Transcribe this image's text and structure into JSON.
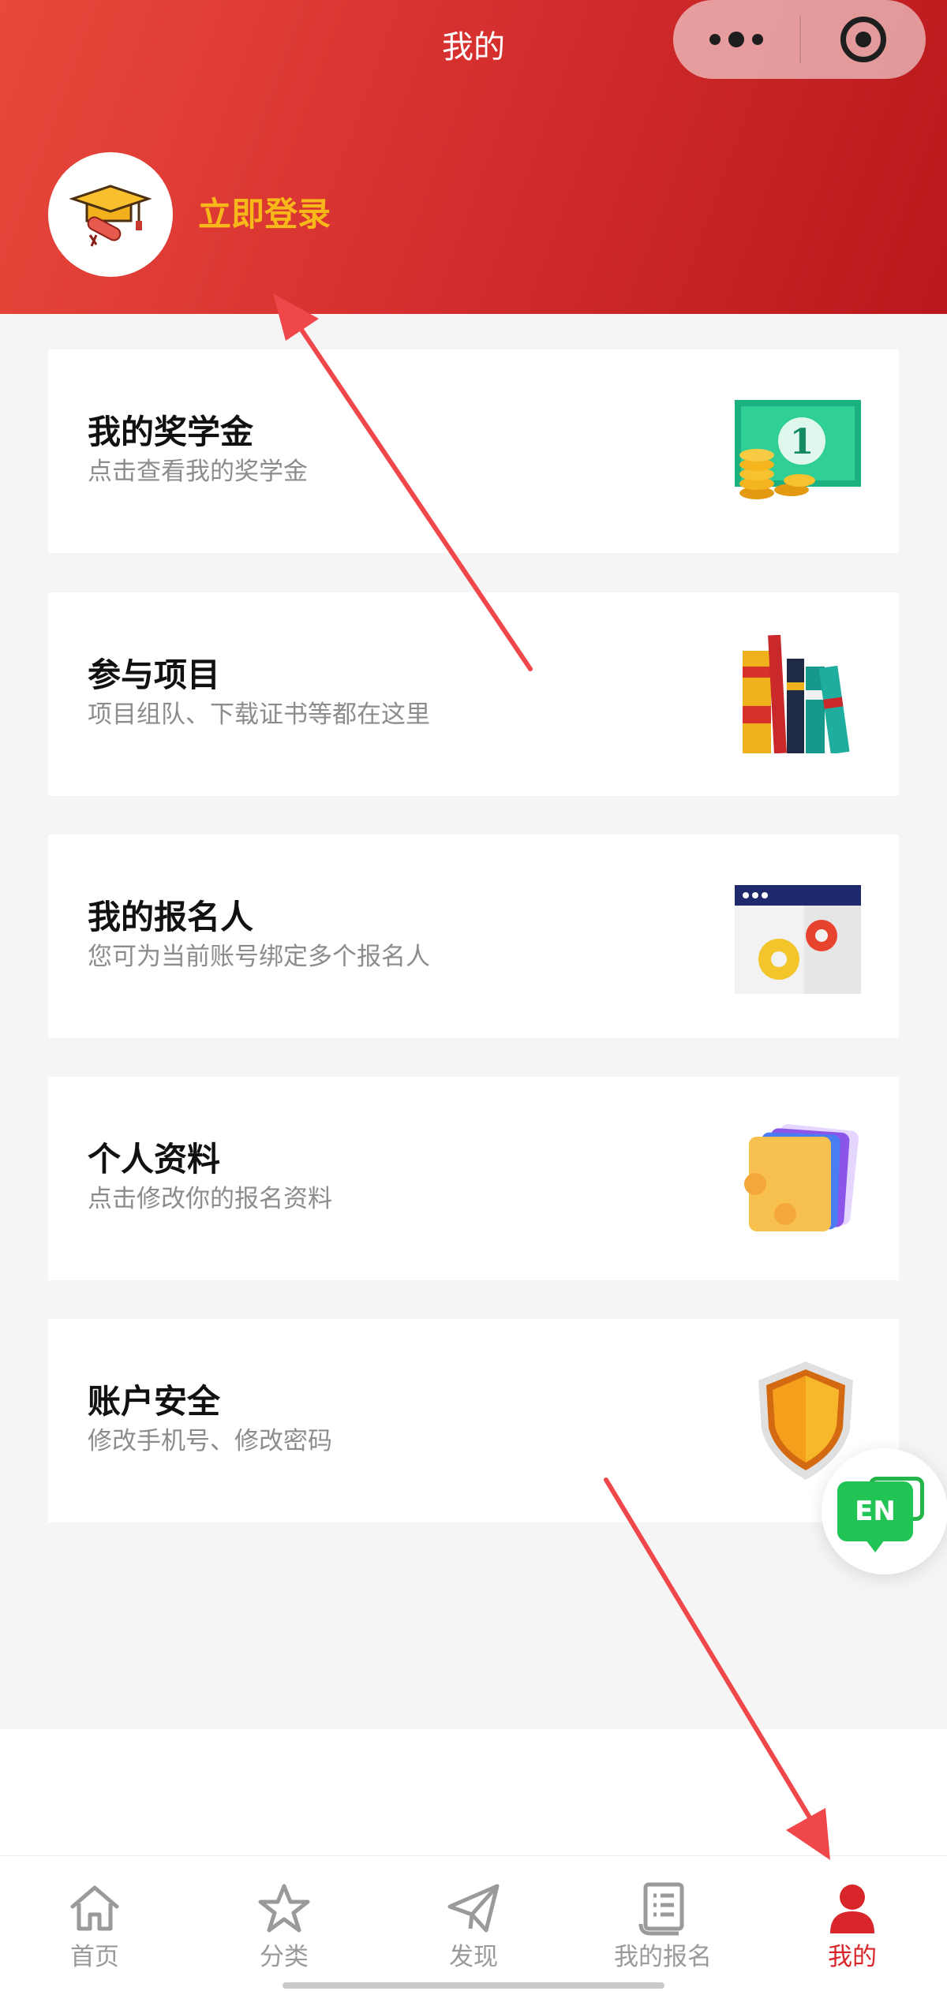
{
  "nav": {
    "title": "我的"
  },
  "profile": {
    "login_label": "立即登录"
  },
  "menu": [
    {
      "title": "我的奖学金",
      "subtitle": "点击查看我的奖学金",
      "icon": "money-icon"
    },
    {
      "title": "参与项目",
      "subtitle": "项目组队、下载证书等都在这里",
      "icon": "books-icon"
    },
    {
      "title": "我的报名人",
      "subtitle": "您可为当前账号绑定多个报名人",
      "icon": "settings-window-icon"
    },
    {
      "title": "个人资料",
      "subtitle": "点击修改你的报名资料",
      "icon": "cards-icon"
    },
    {
      "title": "账户安全",
      "subtitle": "修改手机号、修改密码",
      "icon": "shield-icon"
    }
  ],
  "fab": {
    "label": "EN"
  },
  "tabbar": {
    "items": [
      {
        "label": "首页",
        "icon": "home-icon",
        "active": false
      },
      {
        "label": "分类",
        "icon": "star-icon",
        "active": false
      },
      {
        "label": "发现",
        "icon": "paper-plane-icon",
        "active": false
      },
      {
        "label": "我的报名",
        "icon": "document-icon",
        "active": false
      },
      {
        "label": "我的",
        "icon": "person-icon",
        "active": true
      }
    ]
  },
  "colors": {
    "header_start": "#e8493b",
    "header_end": "#b8181c",
    "login_text": "#f7b81a",
    "active_tab": "#d9262a",
    "annotation_arrow": "#f0474a"
  }
}
